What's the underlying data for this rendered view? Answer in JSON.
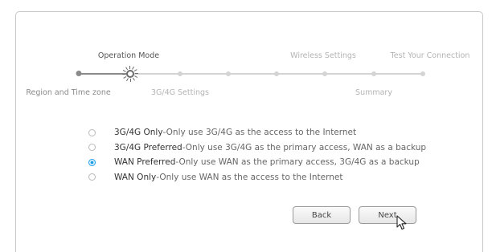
{
  "wizard": {
    "steps": [
      {
        "label": "Region and Time zone",
        "state": "done"
      },
      {
        "label": "Operation Mode",
        "state": "current"
      },
      {
        "label": "3G/4G Settings",
        "state": "future"
      },
      {
        "label": "",
        "state": "future"
      },
      {
        "label": "",
        "state": "future"
      },
      {
        "label": "Wireless Settings",
        "state": "future"
      },
      {
        "label": "Summary",
        "state": "future"
      },
      {
        "label": "Test Your Connection",
        "state": "future"
      }
    ]
  },
  "options": [
    {
      "title": "3G/4G Only",
      "desc": "-Only use 3G/4G as the access to the Internet",
      "checked": false
    },
    {
      "title": "3G/4G Preferred",
      "desc": "-Only use 3G/4G as the primary access, WAN as a backup",
      "checked": false
    },
    {
      "title": "WAN Preferred",
      "desc": "-Only use WAN as the primary access, 3G/4G as a backup",
      "checked": true
    },
    {
      "title": "WAN Only",
      "desc": "-Only use WAN as the access to the Internet",
      "checked": false
    }
  ],
  "buttons": {
    "back": "Back",
    "next": "Next"
  },
  "colors": {
    "accent": "#21a0e8",
    "done": "#8a8a8a",
    "future": "#d4d4d4"
  },
  "icons": {
    "cursor": "arrow-cursor-icon"
  }
}
